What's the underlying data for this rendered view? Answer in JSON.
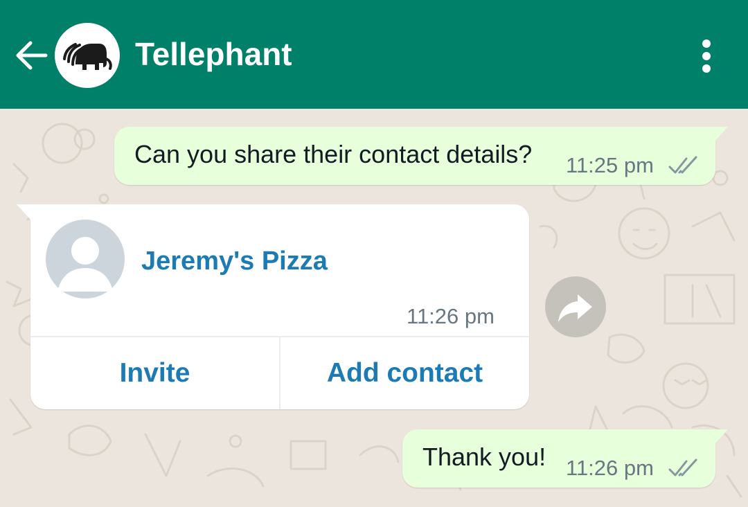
{
  "header": {
    "title": "Tellephant",
    "back_icon": "arrow-left-icon",
    "menu_icon": "more-vertical-icon",
    "avatar_icon": "elephant-logo-icon",
    "background_color": "#008069"
  },
  "messages": [
    {
      "direction": "outgoing",
      "text": "Can you share their contact details?",
      "time": "11:25 pm",
      "status_icon": "double-check-icon"
    },
    {
      "direction": "incoming",
      "type": "contact",
      "contact_name": "Jeremy's Pizza",
      "time": "11:26 pm",
      "avatar_icon": "default-person-icon",
      "actions": [
        {
          "label": "Invite"
        },
        {
          "label": "Add contact"
        }
      ]
    },
    {
      "direction": "outgoing",
      "text": "Thank you!",
      "time": "11:26 pm",
      "status_icon": "double-check-icon"
    }
  ],
  "forward_icon": "forward-arrow-icon",
  "colors": {
    "outgoing_bubble": "#e7ffdb",
    "incoming_bubble": "#ffffff",
    "link_blue": "#1c7bb4",
    "chat_background": "#ece5dd"
  }
}
